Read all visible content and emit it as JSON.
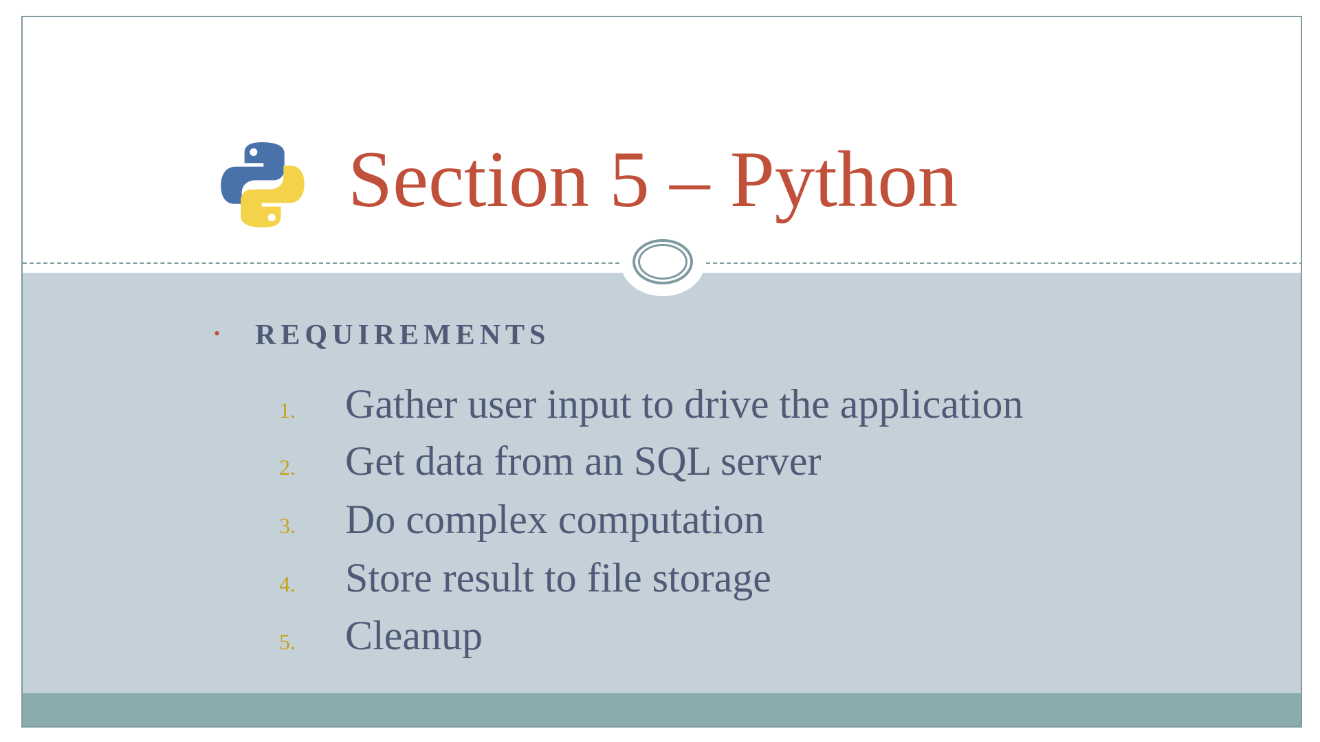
{
  "slide": {
    "title": "Section 5 – Python",
    "logo_icon": "python-logo-icon",
    "subheading": "REQUIREMENTS",
    "requirements": [
      {
        "number": "1.",
        "text": "Gather user input to drive the application"
      },
      {
        "number": "2.",
        "text": "Get data from an SQL server"
      },
      {
        "number": "3.",
        "text": "Do complex computation"
      },
      {
        "number": "4.",
        "text": "Store result to file storage"
      },
      {
        "number": "5.",
        "text": "Cleanup"
      }
    ]
  },
  "colors": {
    "title": "#c0503a",
    "body_text": "#4f5a76",
    "list_number": "#c9a21c",
    "body_background": "#c5d1d8",
    "footer_band": "#8babae",
    "accent_line": "#7f9aa0"
  }
}
